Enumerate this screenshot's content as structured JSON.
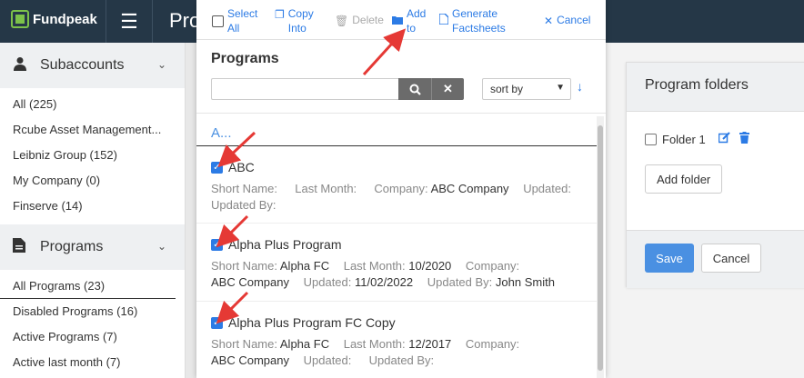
{
  "app": {
    "logo_text": "Fundpeak",
    "page_title_partial": "Pro"
  },
  "sidebar": {
    "subaccounts": {
      "title": "Subaccounts",
      "items": [
        {
          "label": "All (225)"
        },
        {
          "label": "Rcube Asset Management..."
        },
        {
          "label": "Leibniz Group (152)"
        },
        {
          "label": "My Company (0)"
        },
        {
          "label": "Finserve (14)"
        }
      ]
    },
    "programs": {
      "title": "Programs",
      "items": [
        {
          "label": "All Programs (23)"
        },
        {
          "label": "Disabled Programs (16)"
        },
        {
          "label": "Active Programs (7)"
        },
        {
          "label": "Active last month (7)"
        }
      ]
    }
  },
  "toolbar": {
    "select_all": "Select All",
    "copy_into": "Copy Into",
    "delete": "Delete",
    "add_to": "Add to",
    "generate_factsheets": "Generate Factsheets",
    "cancel": "Cancel"
  },
  "modal": {
    "title": "Programs",
    "search_placeholder": "",
    "sort_value": "sort by",
    "group_label": "A..."
  },
  "programs": [
    {
      "name": "ABC",
      "checked": true,
      "meta_line1": [
        {
          "label": "Short Name:",
          "value": ""
        },
        {
          "label": "Last Month:",
          "value": ""
        },
        {
          "label": "Company:",
          "value": "ABC Company"
        },
        {
          "label": "Updated:",
          "value": ""
        }
      ],
      "meta_line2": [
        {
          "label": "Updated By:",
          "value": ""
        }
      ]
    },
    {
      "name": "Alpha Plus Program",
      "checked": true,
      "meta_line1": [
        {
          "label": "Short Name:",
          "value": "Alpha FC"
        },
        {
          "label": "Last Month:",
          "value": "10/2020"
        },
        {
          "label": "Company:",
          "value": ""
        }
      ],
      "meta_line2": [
        {
          "label": "",
          "value": "ABC Company"
        },
        {
          "label": "Updated:",
          "value": "11/02/2022"
        },
        {
          "label": "Updated By:",
          "value": "John Smith"
        }
      ]
    },
    {
      "name": "Alpha Plus Program FC Copy",
      "checked": true,
      "meta_line1": [
        {
          "label": "Short Name:",
          "value": "Alpha FC"
        },
        {
          "label": "Last Month:",
          "value": "12/2017"
        },
        {
          "label": "Company:",
          "value": ""
        }
      ],
      "meta_line2": [
        {
          "label": "",
          "value": "ABC Company"
        },
        {
          "label": "Updated:",
          "value": ""
        },
        {
          "label": "Updated By:",
          "value": ""
        }
      ]
    }
  ],
  "folders": {
    "title": "Program folders",
    "items": [
      {
        "label": "Folder 1"
      }
    ],
    "add_folder": "Add folder",
    "save": "Save",
    "cancel": "Cancel"
  },
  "colors": {
    "nav_bg": "#253747",
    "accent": "#2c7be5",
    "save_button": "#4a90e2",
    "annotation_arrow": "#e53935"
  }
}
